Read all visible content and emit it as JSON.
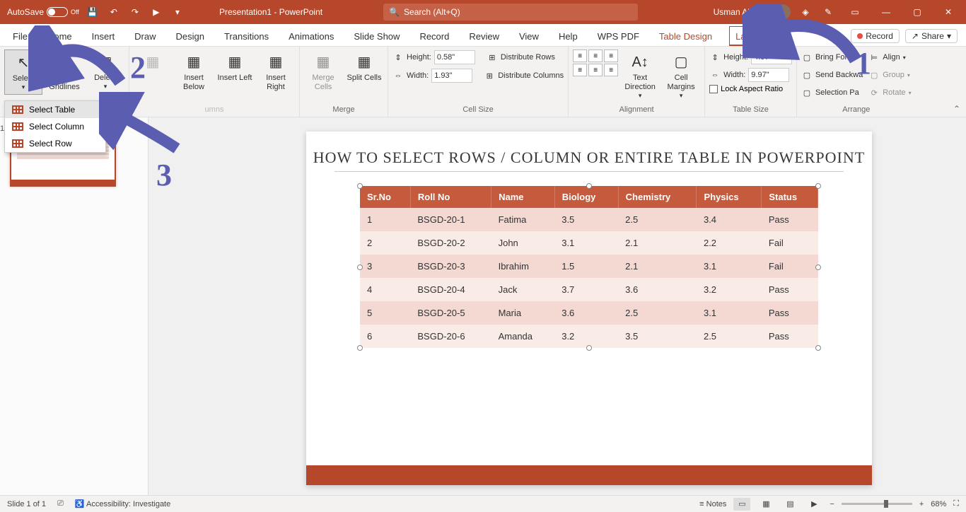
{
  "titlebar": {
    "autosave_label": "AutoSave",
    "autosave_state": "Off",
    "doc_title": "Presentation1 - PowerPoint",
    "search_placeholder": "Search (Alt+Q)",
    "user_name": "Usman Abbasi"
  },
  "tabs": {
    "items": [
      "File",
      "Home",
      "Insert",
      "Draw",
      "Design",
      "Transitions",
      "Animations",
      "Slide Show",
      "Record",
      "Review",
      "View",
      "Help",
      "WPS PDF",
      "Table Design",
      "Layout"
    ],
    "active": "Layout",
    "record_btn": "Record",
    "share_btn": "Share"
  },
  "ribbon": {
    "select_btn": "Select",
    "view_gridlines": "View Gridlines",
    "delete_btn": "Delete",
    "insert_below": "Insert Below",
    "insert_left": "Insert Left",
    "insert_right": "Insert Right",
    "merge_cells": "Merge Cells",
    "split_cells": "Split Cells",
    "group_merge": "Merge",
    "height_label": "Height:",
    "height_val": "0.58\"",
    "width_label": "Width:",
    "width_val": "1.93\"",
    "distribute_rows": "Distribute Rows",
    "distribute_columns": "Distribute Columns",
    "group_cellsize": "Cell Size",
    "text_direction": "Text Direction",
    "cell_margins": "Cell Margins",
    "group_alignment": "Alignment",
    "ts_height_label": "Height:",
    "ts_height_val": "4.07\"",
    "ts_width_label": "Width:",
    "ts_width_val": "9.97\"",
    "lock_aspect": "Lock Aspect Ratio",
    "group_tablesize": "Table Size",
    "bring_forward": "Bring Forwa",
    "send_backward": "Send Backwa",
    "selection_pane": "Selection Pa",
    "align": "Align",
    "group_arr": "Group",
    "rotate": "Rotate",
    "group_arrange": "Arrange"
  },
  "select_menu": {
    "table": "Select Table",
    "column": "Select Column",
    "row": "Select Row"
  },
  "slide": {
    "title": "HOW TO SELECT ROWS / COLUMN OR ENTIRE TABLE IN POWERPOINT",
    "headers": [
      "Sr.No",
      "Roll No",
      "Name",
      "Biology",
      "Chemistry",
      "Physics",
      "Status"
    ],
    "rows": [
      [
        "1",
        "BSGD-20-1",
        "Fatima",
        "3.5",
        "2.5",
        "3.4",
        "Pass"
      ],
      [
        "2",
        "BSGD-20-2",
        "John",
        "3.1",
        "2.1",
        "2.2",
        "Fail"
      ],
      [
        "3",
        "BSGD-20-3",
        "Ibrahim",
        "1.5",
        "2.1",
        "3.1",
        "Fail"
      ],
      [
        "4",
        "BSGD-20-4",
        "Jack",
        "3.7",
        "3.6",
        "3.2",
        "Pass"
      ],
      [
        "5",
        "BSGD-20-5",
        "Maria",
        "3.6",
        "2.5",
        "3.1",
        "Pass"
      ],
      [
        "6",
        "BSGD-20-6",
        "Amanda",
        "3.2",
        "3.5",
        "2.5",
        "Pass"
      ]
    ]
  },
  "statusbar": {
    "slide_info": "Slide 1 of 1",
    "accessibility": "Accessibility: Investigate",
    "notes": "Notes",
    "zoom": "68%"
  },
  "annotations": {
    "n1": "1",
    "n2": "2",
    "n3": "3"
  }
}
